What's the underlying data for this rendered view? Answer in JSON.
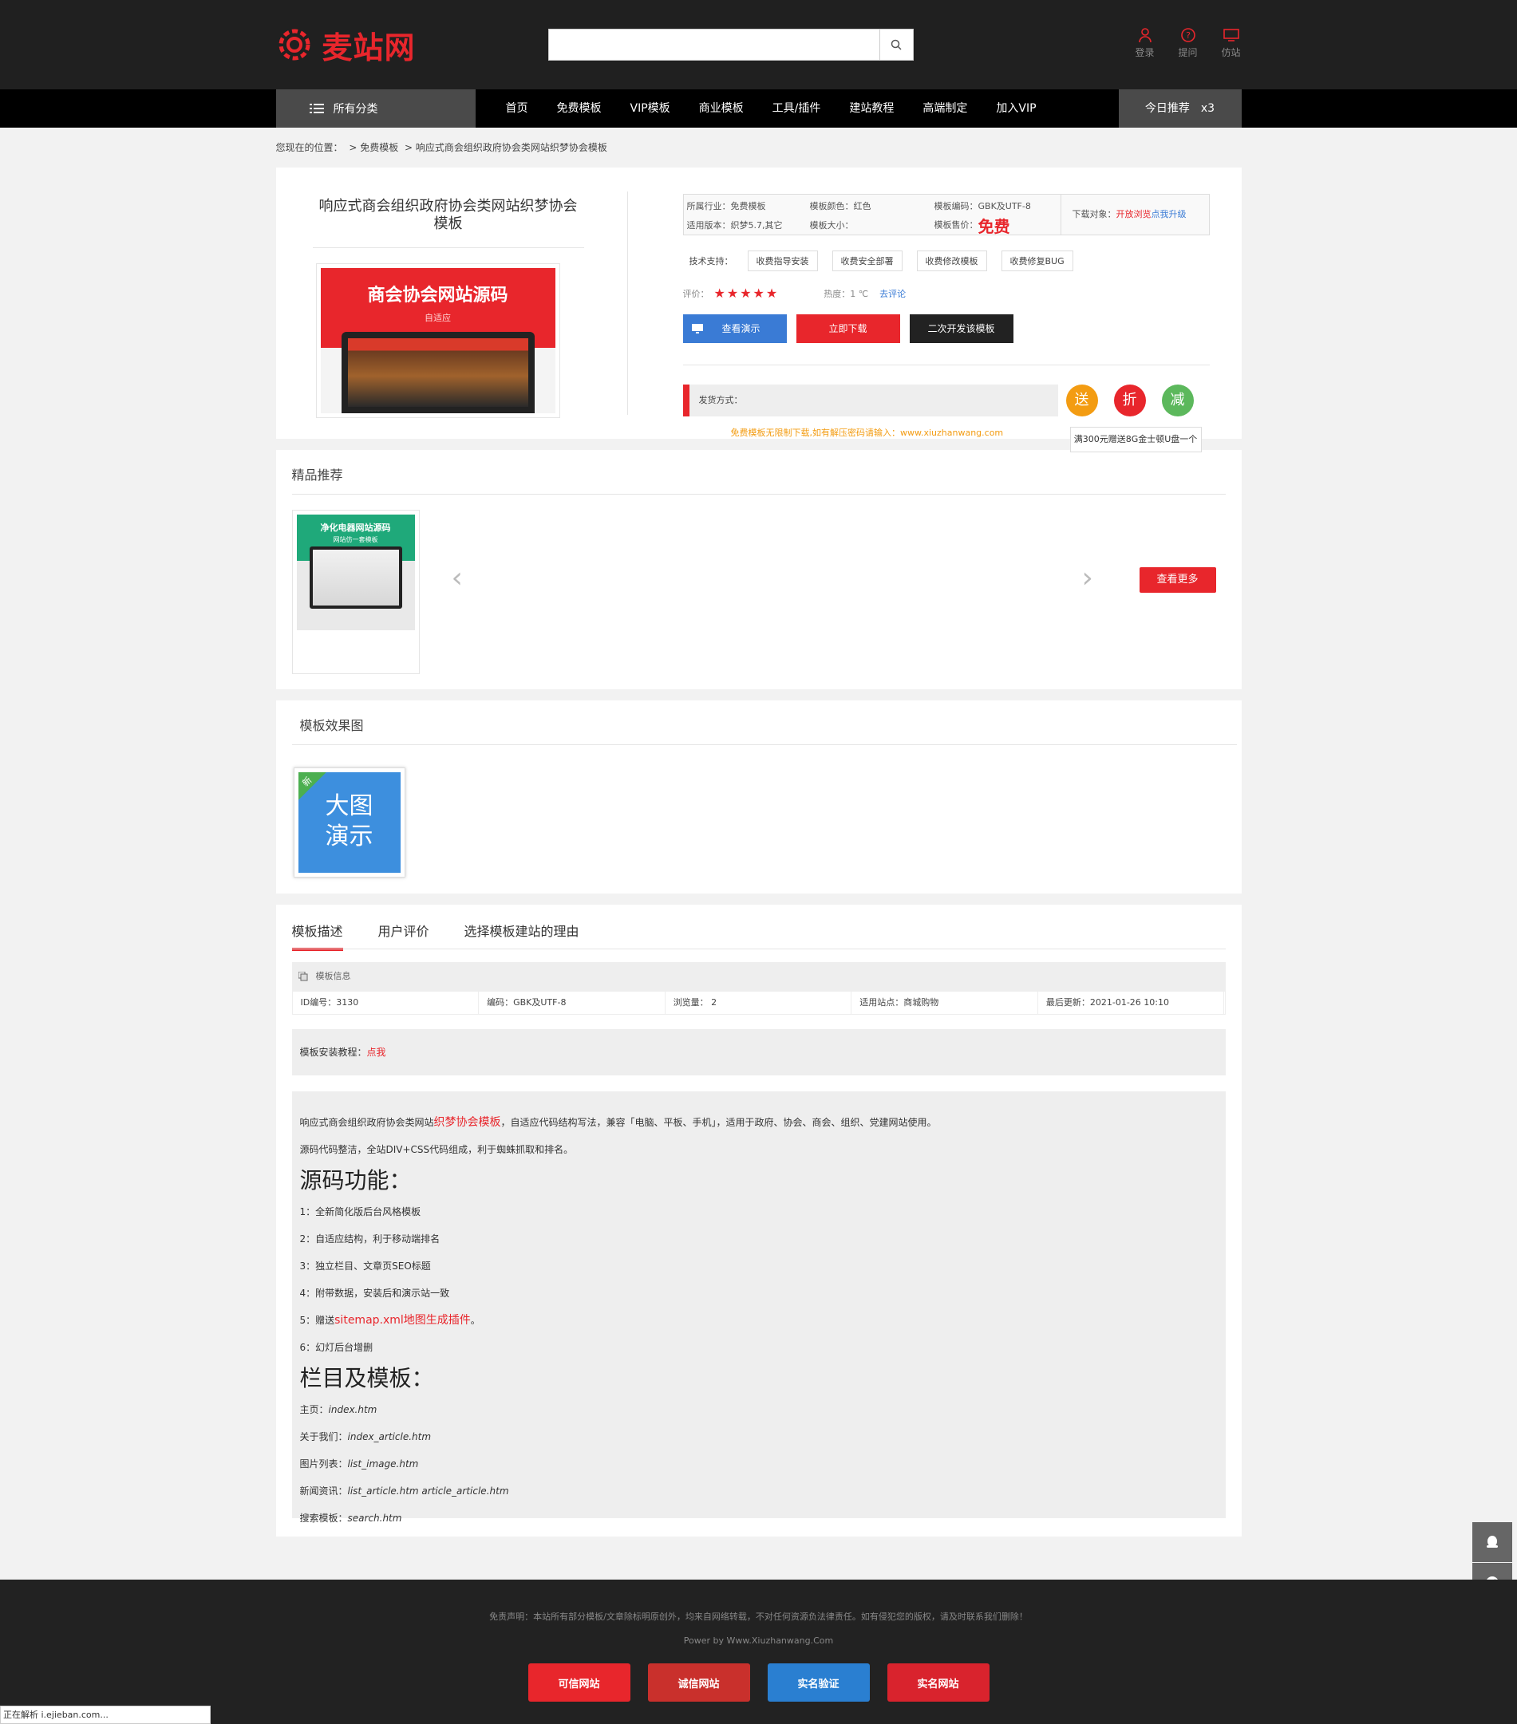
{
  "header": {
    "logo": "麦站网",
    "search_placeholder": "",
    "icons": [
      {
        "name": "user-icon",
        "label": "登录"
      },
      {
        "name": "question-icon",
        "label": "提问"
      },
      {
        "name": "monitor-icon",
        "label": "仿站"
      }
    ]
  },
  "nav": {
    "all": "所有分类",
    "items": [
      "首页",
      "免费模板",
      "VIP模板",
      "商业模板",
      "工具/插件",
      "建站教程",
      "高端制定",
      "加入VIP"
    ],
    "today": "今日推荐　x3"
  },
  "breadcrumb": [
    "您现在的位置：",
    "> 免费模板",
    "> 响应式商会组织政府协会类网站织梦协会模板"
  ],
  "product": {
    "title": "响应式商会组织政府协会类网站织梦协会模板",
    "image_title": "商会协会网站源码",
    "image_sub": "自适应",
    "industry": "所属行业：免费模板",
    "color": "模板颜色：红色",
    "encoding": "模板编码：GBK及UTF-8",
    "version": "适用版本：织梦5.7,其它",
    "size": "模板大小：",
    "price_label": "模板售价：",
    "price": "免费",
    "download_label": "下载对象：",
    "download_value": "开放浏览",
    "upgrade": "点我升级",
    "tech_label": "技术支持：",
    "tech_tags": [
      "收费指导安装",
      "收费安全部署",
      "收费修改模板",
      "收费修复BUG"
    ],
    "rating_label": "评价：",
    "stars": "★★★★★",
    "heat": "热度：1 ℃",
    "comment": "去评论",
    "btn_demo": "查看演示",
    "btn_download": "立即下载",
    "btn_dev": "二次开发该模板",
    "ship_label": "发货方式：",
    "circles": [
      "送",
      "折",
      "减"
    ],
    "note": "免费模板无限制下载,如有解压密码请输入：www.xiuzhanwang.com",
    "tip": "满300元赠送8G金士顿U盘一个"
  },
  "recommend": {
    "title": "精品推荐",
    "thumb_title": "净化电器网站源码",
    "thumb_sub": "网站仿一套模板",
    "more": "查看更多",
    "prev": "‹",
    "next": "›"
  },
  "effects": {
    "title": "模板效果图",
    "thumb_text1": "大图",
    "thumb_text2": "演示",
    "new_tag": "新"
  },
  "desc": {
    "tabs": [
      "模板描述",
      "用户评价",
      "选择模板建站的理由"
    ],
    "info_title": "模板信息",
    "meta": [
      "ID编号：3130",
      "编码：GBK及UTF-8",
      "浏览量： 2",
      "适用站点：商城购物",
      "最后更新：2021-01-26 10:10"
    ],
    "tutorial_label": "模板安装教程：",
    "tutorial_link": "点我",
    "p1a": "响应式商会组织政府协会类网站",
    "p1link": "织梦协会模板",
    "p1b": "，自适应代码结构写法，兼容「电脑、平板、手机」，适用于政府、协会、商会、组织、党建网站使用。",
    "p2": "源码代码整洁，全站DIV+CSS代码组成，利于蜘蛛抓取和排名。",
    "h1": "源码功能：",
    "f1": "1：全新简化版后台风格模板",
    "f2": "2：自适应结构，利于移动端排名",
    "f3": "3：独立栏目、文章页SEO标题",
    "f4": "4：附带数据，安装后和演示站一致",
    "f5a": "5：赠送",
    "f5link": "sitemap.xml地图生成插件",
    "f5b": "。",
    "f6": "6：幻灯后台增删",
    "h2": "栏目及模板：",
    "t1l": "主页：",
    "t1": "index.htm",
    "t2l": "关于我们：",
    "t2": "index_article.htm",
    "t3l": "图片列表：",
    "t3": "list_image.htm",
    "t4l": "新闻资讯：",
    "t4": "list_article.htm article_article.htm",
    "t5l": "搜索模板：",
    "t5": "search.htm"
  },
  "footer": {
    "disclaimer": "免责声明：本站所有部分模板/文章除标明原创外，均来自网络转载，不对任何资源负法律责任。如有侵犯您的版权，请及时联系我们删除！",
    "power": "Power by Www.Xiuzhanwang.Com",
    "badges": [
      "可信网站",
      "诚信网站",
      "实名验证",
      "实名网站"
    ]
  },
  "status": "正在解析 i.ejieban.com..."
}
